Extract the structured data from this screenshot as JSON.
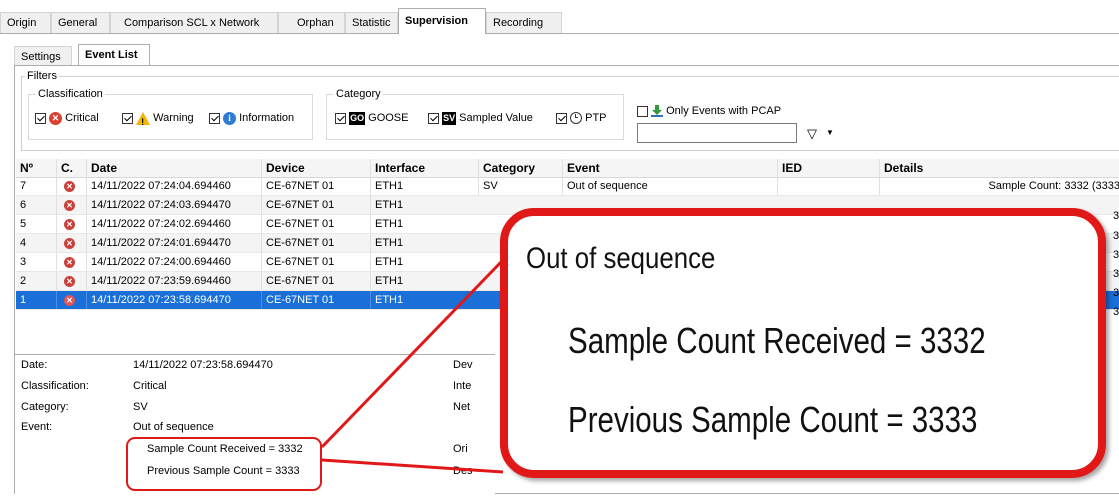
{
  "top_tabs": [
    "Origin",
    "General",
    "Comparison SCL x Network",
    "Orphan",
    "Statistic",
    "Supervision",
    "Recording"
  ],
  "sub_tabs": [
    "Settings",
    "Event List"
  ],
  "filters": {
    "title": "Filters",
    "classification": {
      "label": "Classification",
      "critical": "Critical",
      "warning": "Warning",
      "information": "Information"
    },
    "category": {
      "label": "Category",
      "goose_badge": "GO",
      "goose": "GOOSE",
      "sv_badge": "SV",
      "sampled_value": "Sampled Value",
      "ptp": "PTP"
    },
    "pcap": {
      "label": "Only Events with PCAP",
      "value": ""
    }
  },
  "grid": {
    "columns": [
      "Nº",
      "C.",
      "Date",
      "Device",
      "Interface",
      "Category",
      "Event",
      "IED",
      "Details"
    ],
    "rows": [
      {
        "n": "7",
        "date": "14/11/2022 07:24:04.694460",
        "device": "CE-67NET 01",
        "interface": "ETH1",
        "category": "SV",
        "event": "Out of sequence",
        "details": "Sample Count: 3332 (3333"
      },
      {
        "n": "6",
        "date": "14/11/2022 07:24:03.694470",
        "device": "CE-67NET 01",
        "interface": "ETH1"
      },
      {
        "n": "5",
        "date": "14/11/2022 07:24:02.694460",
        "device": "CE-67NET 01",
        "interface": "ETH1"
      },
      {
        "n": "4",
        "date": "14/11/2022 07:24:01.694470",
        "device": "CE-67NET 01",
        "interface": "ETH1"
      },
      {
        "n": "3",
        "date": "14/11/2022 07:24:00.694460",
        "device": "CE-67NET 01",
        "interface": "ETH1"
      },
      {
        "n": "2",
        "date": "14/11/2022 07:23:59.694460",
        "device": "CE-67NET 01",
        "interface": "ETH1"
      },
      {
        "n": "1",
        "date": "14/11/2022 07:23:58.694470",
        "device": "CE-67NET 01",
        "interface": "ETH1",
        "selected": true
      }
    ],
    "right_edge_fragment": "3"
  },
  "details": {
    "date_label": "Date:",
    "date_value": "14/11/2022 07:23:58.694470",
    "classification_label": "Classification:",
    "classification_value": "Critical",
    "category_label": "Category:",
    "category_value": "SV",
    "event_label": "Event:",
    "event_value": "Out of sequence",
    "line1": "Sample Count Received = 3332",
    "line2": "Previous Sample Count = 3333",
    "right_labels": [
      "Dev",
      "Inte",
      "Net",
      "Ori",
      "Des"
    ]
  },
  "callout": {
    "title": "Out of sequence",
    "line1": "Sample Count Received = 3332",
    "line2": "Previous Sample Count = 3333"
  },
  "colors": {
    "selection": "#1a6fd9",
    "callout_border": "#e01818",
    "critical": "#d8412f"
  }
}
